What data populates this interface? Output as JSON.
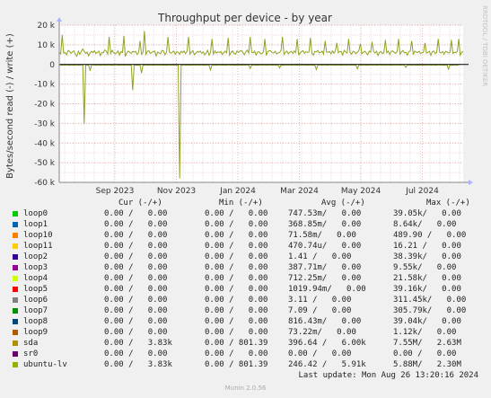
{
  "chart_data": {
    "type": "line",
    "title": "Throughput per device - by year",
    "ylabel": "Bytes/second read (-) / write (+)",
    "ylim": [
      -60000,
      20000
    ],
    "y_ticks": [
      {
        "value": 20000,
        "label": "20 k"
      },
      {
        "value": 10000,
        "label": "10 k"
      },
      {
        "value": 0,
        "label": "0"
      },
      {
        "value": -10000,
        "label": "-10 k"
      },
      {
        "value": -20000,
        "label": "-20 k"
      },
      {
        "value": -30000,
        "label": "-30 k"
      },
      {
        "value": -40000,
        "label": "-40 k"
      },
      {
        "value": -50000,
        "label": "-50 k"
      },
      {
        "value": -60000,
        "label": "-60 k"
      }
    ],
    "x_ticks": [
      "Sep 2023",
      "Nov 2023",
      "Jan 2024",
      "Mar 2024",
      "May 2024",
      "Jul 2024"
    ],
    "grid": true,
    "watermark": "RRDTOOL / TOBI OETIKER",
    "series": [
      {
        "name": "ubuntu-lv",
        "color": "#8fa320",
        "write": [
          6200,
          5400,
          15000,
          5800,
          6100,
          4900,
          7100,
          6600,
          5600,
          6400,
          6900,
          5100,
          4200,
          6800,
          5200,
          6500,
          7900,
          6700,
          5600,
          6300,
          4400,
          5900,
          6700,
          6000,
          7000,
          5500,
          6200,
          6800,
          4500,
          6100,
          5900,
          7400,
          6800,
          5300,
          14000,
          5600,
          7200,
          6100,
          5400,
          5800,
          6900,
          4800,
          6500,
          6100,
          14500,
          4100,
          5900,
          6800,
          6200,
          5700,
          6600,
          6300,
          6700,
          5100,
          5900,
          12000,
          5200,
          6200,
          17000,
          5200,
          6600,
          7000,
          5600,
          6100,
          6500,
          6800,
          4300,
          6300,
          5800,
          5500,
          7100,
          6900,
          4900,
          6200,
          14000,
          6300,
          5700,
          6300,
          6800,
          5200,
          6500,
          6200,
          5200,
          6700,
          6000,
          6900,
          5500,
          6700,
          14000,
          5300,
          6400,
          7000,
          5000,
          5800,
          6600,
          6200,
          6800,
          5700,
          6400,
          4900,
          5800,
          7200,
          4800,
          6100,
          13000,
          5300,
          6900,
          5800,
          6400,
          6100,
          6600,
          5100,
          6000,
          6800,
          5900,
          13500,
          4700,
          6200,
          6900,
          5600,
          5200,
          6800,
          6100,
          6700,
          7100,
          6200,
          4900,
          6400,
          7300,
          5800,
          14000,
          6100,
          5900,
          6800,
          4800,
          6300,
          6500,
          5500,
          5600,
          6400,
          13000,
          4600,
          6600,
          7000,
          6900,
          6000,
          5800,
          6700,
          5400,
          5900,
          6100,
          7200,
          14000,
          5100,
          6200,
          6800,
          5400,
          6300,
          6700,
          5600,
          6900,
          6000,
          13000,
          5000,
          5700,
          6600,
          7000,
          5600,
          6500,
          6100,
          6300,
          13500,
          5500,
          4800,
          6700,
          6400,
          7100,
          5900,
          6100,
          6800,
          5300,
          12000,
          6300,
          6200,
          6600,
          5400,
          6900,
          5700,
          6800,
          11000,
          5900,
          6600,
          6500,
          4800,
          7200,
          6300,
          5800,
          13000,
          6000,
          5200,
          6700,
          6400,
          5500,
          6300,
          7000,
          10500,
          5400,
          6100,
          6700,
          5900,
          4900,
          6800,
          6200,
          11500,
          6600,
          5800,
          6700,
          4600,
          6100,
          6500,
          5600,
          5800,
          12500,
          5900,
          6800,
          5100,
          6600,
          6900,
          6200,
          5700,
          6600,
          13000,
          5300,
          6400,
          7100,
          5900,
          6200,
          4800,
          6500,
          6900,
          12000,
          5000,
          6800,
          6300,
          6100,
          6700,
          5600,
          5900,
          6300,
          11000,
          5800,
          6200,
          6700,
          4700,
          6500,
          6800,
          5500,
          6200,
          13000,
          6100,
          5900,
          6600,
          5200,
          6700,
          6400,
          5800,
          6100,
          12500,
          5600,
          6300,
          5900,
          6600,
          13000,
          4800,
          6200,
          6700
        ],
        "read": [
          -200,
          -300,
          -400,
          -250,
          -350,
          -200,
          -300,
          -500,
          -250,
          -400,
          -300,
          -350,
          -200,
          -450,
          -300,
          -250,
          -400,
          -30000,
          -300,
          -250,
          -350,
          -3200,
          -200,
          -250,
          -300,
          -400,
          -350,
          -250,
          -450,
          -300,
          -200,
          -350,
          -400,
          -250,
          -300,
          -350,
          -450,
          -300,
          -250,
          -200,
          -400,
          -300,
          -350,
          -250,
          -400,
          -300,
          -200,
          -350,
          -400,
          -300,
          -13000,
          -250,
          -350,
          -300,
          -400,
          -250,
          -4400,
          -300,
          -350,
          -200,
          -400,
          -300,
          -250,
          -350,
          -300,
          -400,
          -200,
          -350,
          -300,
          -250,
          -400,
          -300,
          -350,
          -450,
          -250,
          -300,
          -400,
          -200,
          -350,
          -300,
          -250,
          -400,
          -58000,
          -300,
          -350,
          -200,
          -400,
          -250,
          -350,
          -300,
          -400,
          -250,
          -300,
          -350,
          -200,
          -400,
          -300,
          -250,
          -350,
          -400,
          -300,
          -200,
          -350,
          -2800,
          -300,
          -250,
          -400,
          -350,
          -300,
          -200,
          -400,
          -250,
          -350,
          -300,
          -400,
          -200,
          -300,
          -350,
          -250,
          -400,
          -300,
          -350,
          -200,
          -300,
          -400,
          -250,
          -350,
          -300,
          -200,
          -400,
          -2000,
          -350,
          -300,
          -250,
          -400,
          -300,
          -350,
          -200,
          -400,
          -250,
          -300,
          -350,
          -400,
          -200,
          -300,
          -350,
          -250,
          -400,
          -300,
          -200,
          -1800,
          -350,
          -300,
          -400,
          -250,
          -300,
          -350,
          -200,
          -400,
          -300,
          -250,
          -350,
          -400,
          -300,
          -200,
          -350,
          -300,
          -250,
          -400,
          -300,
          -350,
          -200,
          -300,
          -400,
          -250,
          -2600,
          -350,
          -300,
          -200,
          -400,
          -250,
          -300,
          -350,
          -400,
          -200,
          -300,
          -350,
          -250,
          -400,
          -300,
          -200,
          -350,
          -300,
          -400,
          -250,
          -300,
          -350,
          -200,
          -400,
          -300,
          -250,
          -350,
          -400,
          -2200,
          -300,
          -200,
          -350,
          -300,
          -250,
          -400,
          -300,
          -350,
          -200,
          -400,
          -250,
          -300,
          -350,
          -400,
          -200,
          -300,
          -350,
          -250,
          -400,
          -300,
          -200,
          -350,
          -300,
          -400,
          -250,
          -300,
          -350,
          -200,
          -400,
          -300,
          -250,
          -350,
          -1500,
          -400,
          -300,
          -200,
          -350,
          -300,
          -250,
          -400,
          -300,
          -350,
          -200,
          -300,
          -400,
          -250,
          -350,
          -300,
          -200,
          -400,
          -250,
          -300,
          -350,
          -400,
          -200,
          -300,
          -350,
          -250,
          -400,
          -300,
          -200,
          -2400,
          -350,
          -300,
          -400,
          -250,
          -300,
          -350,
          -200
        ]
      }
    ]
  },
  "legend": {
    "headers": {
      "cur": "Cur (-/+)",
      "min": "Min (-/+)",
      "avg": "Avg (-/+)",
      "max": "Max (-/+)"
    },
    "rows": [
      {
        "name": "loop0",
        "color": "#00cc00",
        "cur": "0.00 /   0.00",
        "min": "0.00 /   0.00",
        "avg": "747.53m/   0.00",
        "max": "39.05k/   0.00"
      },
      {
        "name": "loop1",
        "color": "#0066b3",
        "cur": "0.00 /   0.00",
        "min": "0.00 /   0.00",
        "avg": "368.85m/   0.00",
        "max": "8.64k/   0.00"
      },
      {
        "name": "loop10",
        "color": "#ff8000",
        "cur": "0.00 /   0.00",
        "min": "0.00 /   0.00",
        "avg": "71.58m/   0.00",
        "max": "489.90 /   0.00"
      },
      {
        "name": "loop11",
        "color": "#ffcc00",
        "cur": "0.00 /   0.00",
        "min": "0.00 /   0.00",
        "avg": "470.74u/   0.00",
        "max": "16.21 /   0.00"
      },
      {
        "name": "loop2",
        "color": "#330099",
        "cur": "0.00 /   0.00",
        "min": "0.00 /   0.00",
        "avg": "1.41 /   0.00",
        "max": "38.39k/   0.00"
      },
      {
        "name": "loop3",
        "color": "#990099",
        "cur": "0.00 /   0.00",
        "min": "0.00 /   0.00",
        "avg": "387.71m/   0.00",
        "max": "9.55k/   0.00"
      },
      {
        "name": "loop4",
        "color": "#ccff00",
        "cur": "0.00 /   0.00",
        "min": "0.00 /   0.00",
        "avg": "712.25m/   0.00",
        "max": "21.58k/   0.00"
      },
      {
        "name": "loop5",
        "color": "#ff0000",
        "cur": "0.00 /   0.00",
        "min": "0.00 /   0.00",
        "avg": "1019.94m/   0.00",
        "max": "39.16k/   0.00"
      },
      {
        "name": "loop6",
        "color": "#808080",
        "cur": "0.00 /   0.00",
        "min": "0.00 /   0.00",
        "avg": "3.11 /   0.00",
        "max": "311.45k/   0.00"
      },
      {
        "name": "loop7",
        "color": "#008f00",
        "cur": "0.00 /   0.00",
        "min": "0.00 /   0.00",
        "avg": "7.09 /   0.00",
        "max": "305.79k/   0.00"
      },
      {
        "name": "loop8",
        "color": "#00487d",
        "cur": "0.00 /   0.00",
        "min": "0.00 /   0.00",
        "avg": "816.43m/   0.00",
        "max": "39.04k/   0.00"
      },
      {
        "name": "loop9",
        "color": "#b35a00",
        "cur": "0.00 /   0.00",
        "min": "0.00 /   0.00",
        "avg": "73.22m/   0.00",
        "max": "1.12k/   0.00"
      },
      {
        "name": "sda",
        "color": "#b38f00",
        "cur": "0.00 /   3.83k",
        "min": "0.00 / 801.39",
        "avg": "396.64 /   6.00k",
        "max": "7.55M/   2.63M"
      },
      {
        "name": "sr0",
        "color": "#6b006b",
        "cur": "0.00 /   0.00",
        "min": "0.00 /   0.00",
        "avg": "0.00 /   0.00",
        "max": "0.00 /   0.00"
      },
      {
        "name": "ubuntu-lv",
        "color": "#8fb300",
        "cur": "0.00 /   3.83k",
        "min": "0.00 / 801.39",
        "avg": "246.42 /   5.91k",
        "max": "5.88M/   2.30M"
      }
    ]
  },
  "footer": {
    "last_update": "Last update: Mon Aug 26 13:20:16 2024",
    "munin_version": "Munin 2.0.56"
  }
}
